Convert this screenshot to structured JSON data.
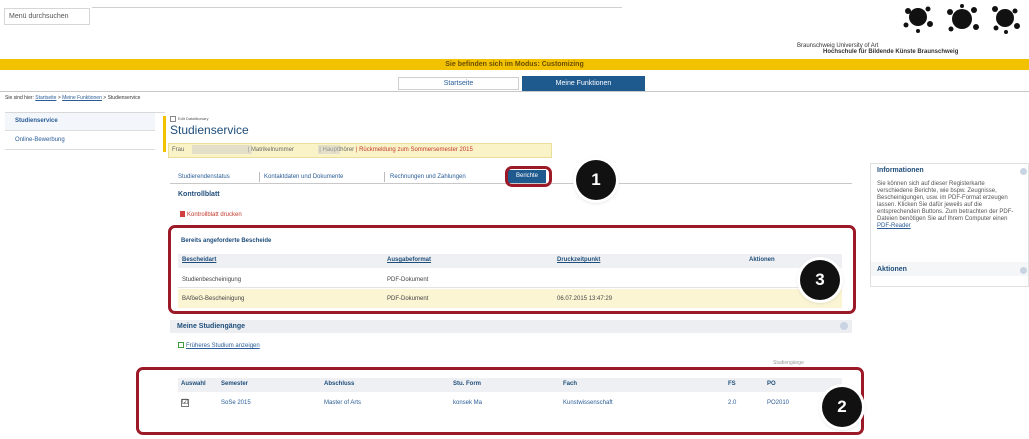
{
  "header": {
    "menu_search": "Menü durchsuchen",
    "university_line1": "Braunschweig University of Art",
    "university_line2": "Hochschule für Bildende Künste Braunschweig",
    "mode_text": "Sie befinden sich im Modus: Customizing"
  },
  "main_tabs": {
    "start": "Startseite",
    "functions": "Meine Funktionen"
  },
  "breadcrumb": {
    "prefix": "Sie sind hier:",
    "item1": "Startseite",
    "sep": ">",
    "item2": "Meine Funktionen",
    "item3": "Studienservice"
  },
  "sidebar": {
    "items": [
      {
        "label": "Studienservice"
      },
      {
        "label": "Online-Bewerbung"
      }
    ]
  },
  "page": {
    "edit_label": "Edit Datatlkonary",
    "title": "Studienservice",
    "info_prefix": "Frau",
    "info_mid1": "| Matrikelnummer",
    "info_mid2": "| Hauptthörer",
    "info_alert": "| Rückmeldung zum Sommersemester 2015"
  },
  "sub_tabs": {
    "items": [
      {
        "label": "Studierendenstatus"
      },
      {
        "label": "Kontaktdaten und Dokumente"
      },
      {
        "label": "Rechnungen und Zahlungen"
      },
      {
        "label": "Berichte"
      }
    ]
  },
  "kontrollblatt": {
    "title": "Kontrollblatt",
    "link": "Kontrollblatt drucken"
  },
  "bescheide": {
    "title": "Bereits angeforderte Bescheide",
    "columns": [
      "Bescheidart",
      "Ausgabeformat",
      "Druckzeitpunkt",
      "Aktionen"
    ],
    "rows": [
      [
        "Studienbescheinigung",
        "PDF-Dokument",
        "",
        ""
      ],
      [
        "BAföeG-Bescheinigung",
        "PDF-Dokument",
        "06.07.2015 13:47:29",
        ""
      ]
    ]
  },
  "studiengaenge": {
    "title": "Meine Studiengänge",
    "earlier_link": "Früheres Studium anzeigen",
    "small_link": "Studiengänge",
    "columns": [
      "Auswahl",
      "Semester",
      "Abschluss",
      "Stu. Form",
      "Fach",
      "FS",
      "PO"
    ],
    "row": [
      "☑",
      "SoSe 2015",
      "Master of Arts",
      "konsek Ma",
      "Kunstwissenschaft",
      "2.0",
      "PO2010"
    ]
  },
  "info_panel": {
    "title": "Informationen",
    "text": "Sie können sich auf dieser Registerkarte verschiedene Berichte, wie bspw. Zeugnisse, Bescheinigungen, usw. im PDF-Format erzeugen lassen. Klicken Sie dafür jeweils auf die entsprechenden Buttons. Zum betrachten der PDF-Dateien benötigen Sie auf Ihrem Computer einen",
    "link": "PDF-Reader",
    "actions_title": "Aktionen"
  },
  "callouts": [
    "1",
    "2",
    "3"
  ],
  "colors": {
    "mode_bar": "#f2c200",
    "active_tab": "#1f5a8f",
    "callout_border": "#9c1a28",
    "highlight_row": "#fbf5d4"
  }
}
